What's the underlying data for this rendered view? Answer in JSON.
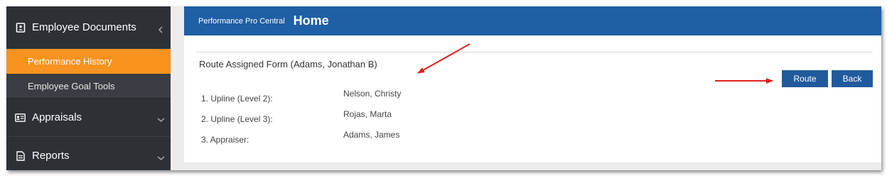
{
  "sidebar": {
    "sections": [
      {
        "label": "Employee Documents",
        "icon": "document-icon",
        "expanded": true
      },
      {
        "label": "Appraisals",
        "icon": "id-card-icon",
        "expanded": false
      },
      {
        "label": "Reports",
        "icon": "report-icon",
        "expanded": false
      }
    ],
    "items": [
      {
        "label": "Performance History",
        "active": true
      },
      {
        "label": "Employee Goal Tools",
        "active": false
      }
    ]
  },
  "header": {
    "brand": "Performance Pro Central",
    "title": "Home"
  },
  "form": {
    "title": "Route Assigned Form (Adams, Jonathan B)",
    "rows": [
      {
        "label": "1. Upline (Level 2):",
        "value": "Nelson, Christy"
      },
      {
        "label": "2. Upline (Level 3):",
        "value": "Rojas, Marta"
      },
      {
        "label": "3. Appraiser:",
        "value": "Adams, James"
      }
    ]
  },
  "buttons": {
    "route": "Route",
    "back": "Back"
  },
  "colors": {
    "header": "#1f5fa5",
    "button": "#215a9c",
    "active_item": "#f7931e",
    "sidebar": "#2d3035",
    "annotation_arrow": "#e0201c"
  }
}
